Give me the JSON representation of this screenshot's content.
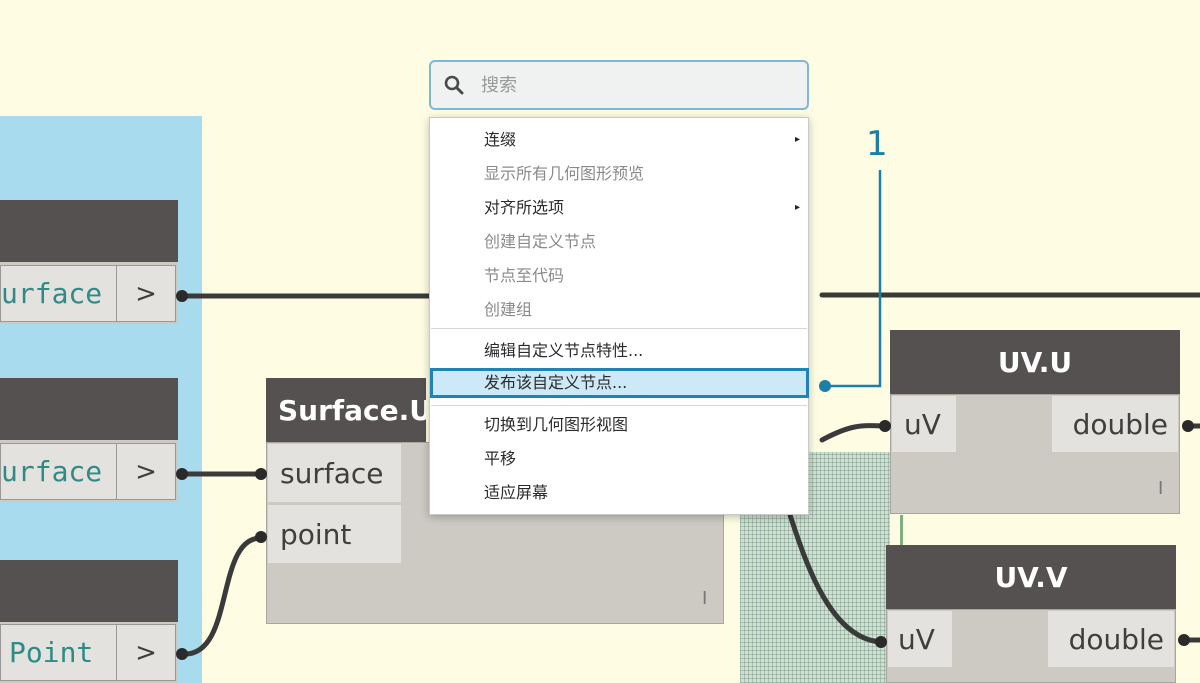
{
  "search": {
    "placeholder": "搜索"
  },
  "context_menu": {
    "items": [
      {
        "label": "连缀",
        "disabled": false,
        "submenu": true
      },
      {
        "label": "显示所有几何图形预览",
        "disabled": true
      },
      {
        "label": "对齐所选项",
        "disabled": false,
        "submenu": true
      },
      {
        "label": "创建自定义节点",
        "disabled": true
      },
      {
        "label": "节点至代码",
        "disabled": true
      },
      {
        "label": "创建组",
        "disabled": true
      },
      {
        "label": "编辑自定义节点特性...",
        "disabled": false
      },
      {
        "label": "发布该自定义节点...",
        "disabled": false,
        "highlighted": true
      },
      {
        "label": "切换到几何图形视图",
        "disabled": false
      },
      {
        "label": "平移",
        "disabled": false
      },
      {
        "label": "适应屏幕",
        "disabled": false
      }
    ],
    "submenu_arrow": "▸"
  },
  "callout": {
    "number": "1"
  },
  "nodes": {
    "left_top": {
      "output": "urface",
      "arrow": ">"
    },
    "left_middle": {
      "output": "urface",
      "arrow": ">"
    },
    "left_bottom": {
      "output": "Point",
      "arrow": ">"
    },
    "surface_uv": {
      "title": "Surface.UV",
      "inputs": [
        "surface",
        "point"
      ],
      "lacing": "I"
    },
    "uv_u": {
      "title": "UV.U",
      "input": "uV",
      "output": "double",
      "lacing": "I"
    },
    "uv_v": {
      "title": "UV.V",
      "input": "uV",
      "output": "double"
    }
  },
  "colors": {
    "canvas": "#fefde3",
    "group": "#a8dbee",
    "node_header": "#545150",
    "node_body": "#cdc9c3",
    "highlight": "#cde8f7",
    "highlight_border": "#1f84b5",
    "callout": "#1b7fa8"
  }
}
